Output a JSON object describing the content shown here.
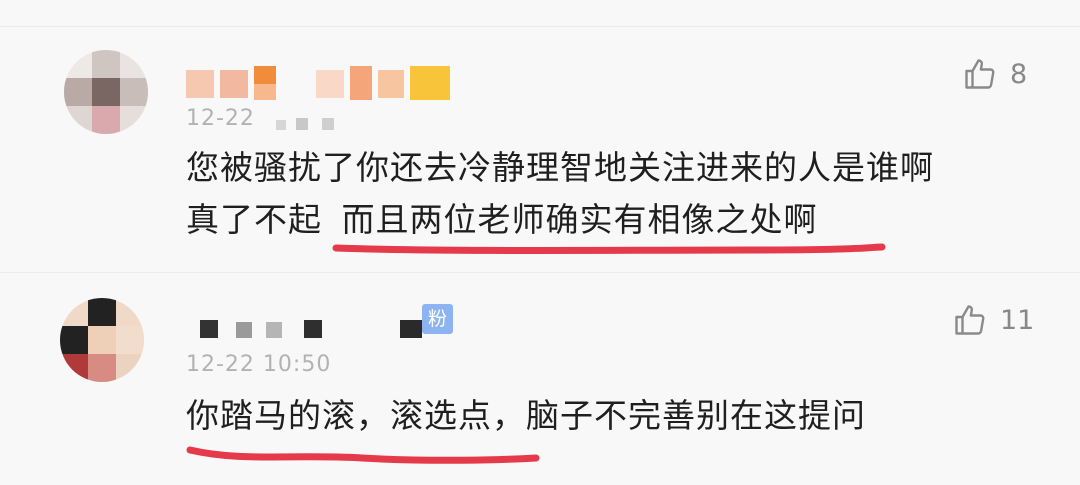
{
  "comments": [
    {
      "timestamp": "12-22",
      "text_line1": "您被骚扰了你还去冷静理智地关注进来的人是谁啊",
      "text_line2_plain": "真了不起",
      "text_line2_marked": "而且两位老师确实有相像之处啊",
      "likes": "8",
      "like_icon": "thumbs-up-icon",
      "underline_color": "#e53a4a"
    },
    {
      "timestamp": "12-22 10:50",
      "badge": "粉",
      "text_marked": "你踏马的滚，滚选点，",
      "text_plain": "脑子不完善别在这提问",
      "likes": "11",
      "like_icon": "thumbs-up-icon",
      "underline_color": "#e53a4a"
    }
  ]
}
